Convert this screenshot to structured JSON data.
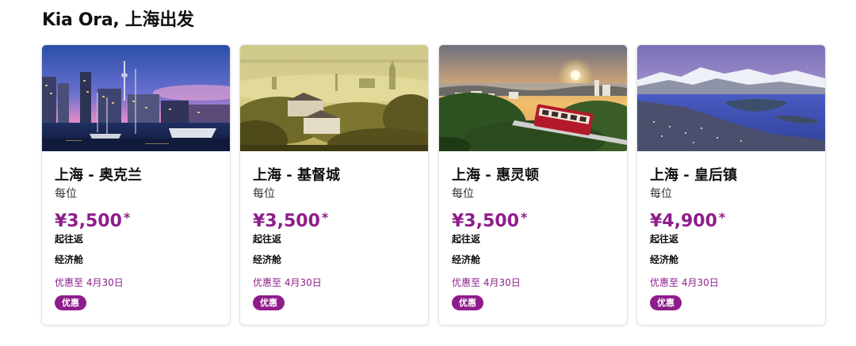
{
  "section": {
    "title": "Kia Ora, 上海出发"
  },
  "colors": {
    "accent": "#8e1d8b",
    "text": "#111111",
    "card_border": "#e4e4e4"
  },
  "cards": [
    {
      "route": "上海 - 奥克兰",
      "per": "每位",
      "price": "¥3,500",
      "asterisk": "*",
      "trip": "起往返",
      "cabin": "经济舱",
      "until": "优惠至 4月30日",
      "badge": "优惠"
    },
    {
      "route": "上海 - 基督城",
      "per": "每位",
      "price": "¥3,500",
      "asterisk": "*",
      "trip": "起往返",
      "cabin": "经济舱",
      "until": "优惠至 4月30日",
      "badge": "优惠"
    },
    {
      "route": "上海 - 惠灵顿",
      "per": "每位",
      "price": "¥3,500",
      "asterisk": "*",
      "trip": "起往返",
      "cabin": "经济舱",
      "until": "优惠至 4月30日",
      "badge": "优惠"
    },
    {
      "route": "上海 - 皇后镇",
      "per": "每位",
      "price": "¥4,900",
      "asterisk": "*",
      "trip": "起往返",
      "cabin": "经济舱",
      "until": "优惠至 4月30日",
      "badge": "优惠"
    }
  ]
}
